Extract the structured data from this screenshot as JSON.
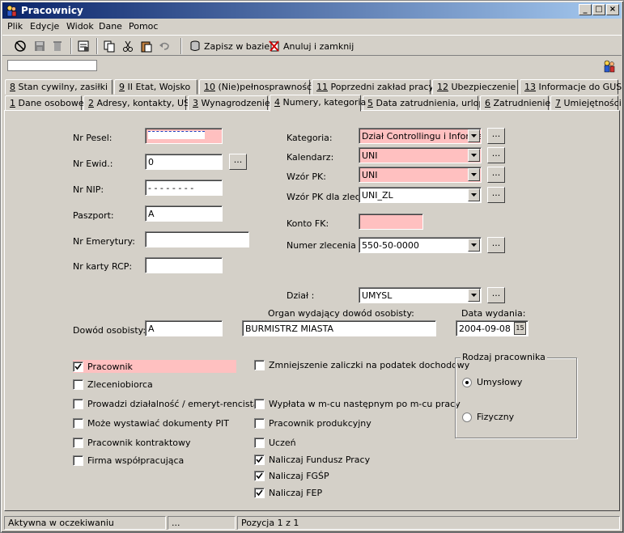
{
  "window": {
    "title": "Pracownicy"
  },
  "menu": [
    "Plik",
    "Edycje",
    "Widok",
    "Dane",
    "Pomoc"
  ],
  "toolbar": {
    "save_label": "Zapisz w bazie",
    "cancel_label": "Anuluj i zamknij"
  },
  "tabs_row1": [
    {
      "num": "8",
      "label": " Stan cywilny, zasiłki"
    },
    {
      "num": "9",
      "label": " II Etat, Wojsko"
    },
    {
      "num": "10",
      "label": " (Nie)pełnosprawność"
    },
    {
      "num": "11",
      "label": " Poprzedni zakład pracy"
    },
    {
      "num": "12",
      "label": " Ubezpieczenie"
    },
    {
      "num": "13",
      "label": " Informacje do GUS"
    }
  ],
  "tabs_row2": [
    {
      "num": "1",
      "label": " Dane osobowe"
    },
    {
      "num": "2",
      "label": " Adresy, kontakty, US"
    },
    {
      "num": "3",
      "label": " Wynagrodzenie"
    },
    {
      "num": "4",
      "label": " Numery, kategoria"
    },
    {
      "num": "5",
      "label": " Data zatrudnienia, urlop"
    },
    {
      "num": "6",
      "label": " Zatrudnienie"
    },
    {
      "num": "7",
      "label": " Umiejętności"
    }
  ],
  "left": {
    "pesel_label": "Nr Pesel:",
    "ewid_label": "Nr Ewid.:",
    "ewid_value": "0",
    "nip_label": "Nr NIP:",
    "nip_value": "- - - - - - - -",
    "paszport_label": "Paszport:",
    "paszport_value": "A",
    "emerytury_label": "Nr Emerytury:",
    "rcp_label": "Nr karty RCP:"
  },
  "right": {
    "kategoria_label": "Kategoria:",
    "kategoria_value": "Dział Controllingu i Informat",
    "kalendarz_label": "Kalendarz:",
    "kalendarz_value": "UNI",
    "wzorpk_label": "Wzór PK:",
    "wzorpk_value": "UNI",
    "wzorpkzlec_label": "Wzór PK dla zlec.:",
    "wzorpkzlec_value": "UNI_ZL",
    "kontofk_label": "Konto FK:",
    "zlecenie_label": "Numer zlecenia :",
    "zlecenie_value": "550-50-0000",
    "dzial_label": "Dział :",
    "dzial_value": "UMYSL"
  },
  "dowod": {
    "label": "Dowód osobisty:",
    "value": "A",
    "organ_label": "Organ wydający dowód osobisty:",
    "organ_value": "BURMISTRZ MIASTA",
    "data_label": "Data wydania:",
    "data_value": "2004-09-08",
    "cal_text": "15"
  },
  "checks_left": [
    {
      "label": "Pracownik",
      "checked": true
    },
    {
      "label": "Zleceniobiorca",
      "checked": false
    },
    {
      "label": "Prowadzi działalność / emeryt-rencista",
      "checked": false
    },
    {
      "label": "Może wystawiać dokumenty PIT",
      "checked": false
    },
    {
      "label": "Pracownik kontraktowy",
      "checked": false
    },
    {
      "label": "Firma współpracująca",
      "checked": false
    }
  ],
  "checks_mid": [
    {
      "label": "Zmniejszenie zaliczki na podatek dochodowy",
      "checked": false
    },
    {
      "label": "Wypłata w m-cu następnym po m-cu pracy",
      "checked": false
    },
    {
      "label": "Pracownik produkcyjny",
      "checked": false
    },
    {
      "label": "Uczeń",
      "checked": false
    },
    {
      "label": "Naliczaj Fundusz Pracy",
      "checked": true
    },
    {
      "label": "Naliczaj FGŚP",
      "checked": true
    },
    {
      "label": "Naliczaj FEP",
      "checked": true
    }
  ],
  "rodzaj": {
    "title": "Rodzaj pracownika",
    "options": [
      {
        "label": "Umysłowy",
        "selected": true
      },
      {
        "label": "Fizyczny",
        "selected": false
      }
    ]
  },
  "status": {
    "state": "Aktywna w oczekiwaniu",
    "middle": "...",
    "position": "Pozycja 1 z 1"
  },
  "colors": {
    "required": "#ffc0c0",
    "titlebar": "#0a246a"
  }
}
